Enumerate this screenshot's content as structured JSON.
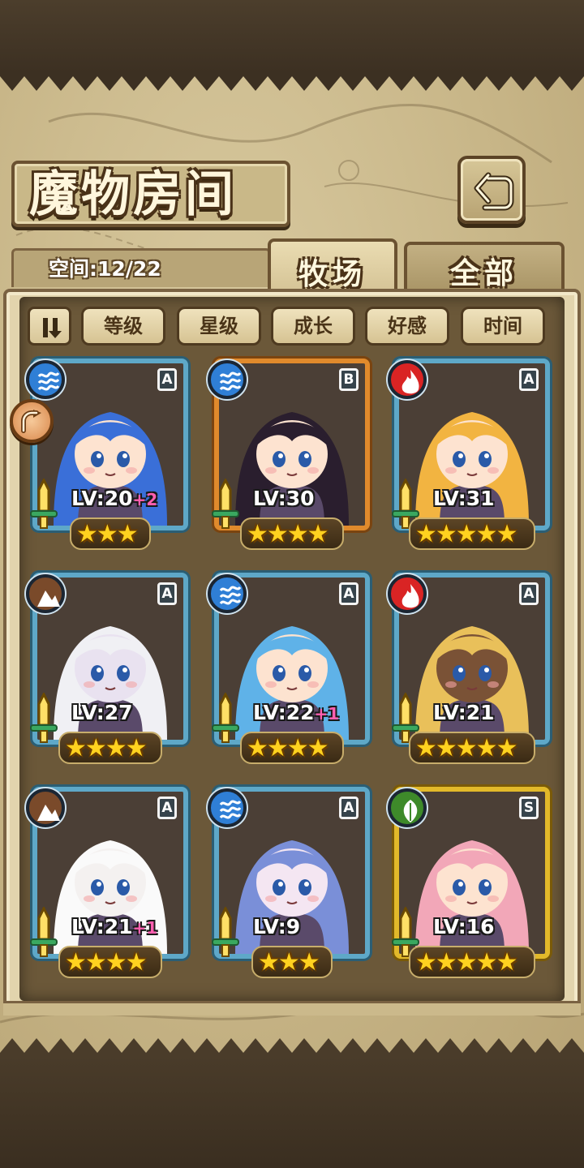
{
  "header": {
    "title": "魔物房间",
    "back_icon": "return-arrow-icon"
  },
  "tabs": {
    "capacity_text": "空间:12/22",
    "ranch_label": "牧场",
    "all_label": "全部",
    "active": "牧场"
  },
  "sort": {
    "toggle_icon": "sort-order-icon",
    "buttons": [
      "等级",
      "星级",
      "成长",
      "好感",
      "时间"
    ]
  },
  "colors": {
    "water": "#2f7fd6",
    "fire": "#d92424",
    "earth": "#7a4a2a",
    "nature": "#3e8a2a",
    "star": "#ffd21f",
    "bonus": "#ff5fb0"
  },
  "monsters": [
    {
      "element": "water",
      "rank": "A",
      "level": "LV:20",
      "bonus": "+2",
      "stars": "★★★",
      "star_count": 3,
      "hair": "#3a6fd8",
      "skin": "#fde3d0"
    },
    {
      "element": "water",
      "rank": "B",
      "level": "LV:30",
      "bonus": "",
      "stars": "★★★★",
      "star_count": 4,
      "hair": "#2a1e2e",
      "skin": "#fde3d0"
    },
    {
      "element": "fire",
      "rank": "A",
      "level": "LV:31",
      "bonus": "",
      "stars": "★★★★★",
      "star_count": 5,
      "hair": "#f2b441",
      "skin": "#fde3d0"
    },
    {
      "element": "earth",
      "rank": "A",
      "level": "LV:27",
      "bonus": "",
      "stars": "★★★★",
      "star_count": 4,
      "hair": "#f0f0f4",
      "skin": "#e9e2f0"
    },
    {
      "element": "water",
      "rank": "A",
      "level": "LV:22",
      "bonus": "+1",
      "stars": "★★★★",
      "star_count": 4,
      "hair": "#5fb2e8",
      "skin": "#fde3d0"
    },
    {
      "element": "fire",
      "rank": "A",
      "level": "LV:21",
      "bonus": "",
      "stars": "★★★★★",
      "star_count": 5,
      "hair": "#e9c05a",
      "skin": "#7a5236"
    },
    {
      "element": "earth",
      "rank": "A",
      "level": "LV:21",
      "bonus": "+1",
      "stars": "★★★★",
      "star_count": 4,
      "hair": "#fafafa",
      "skin": "#f4f1f0"
    },
    {
      "element": "water",
      "rank": "A",
      "level": "LV:9",
      "bonus": "",
      "stars": "★★★",
      "star_count": 3,
      "hair": "#7a8fd8",
      "skin": "#f4e6f2"
    },
    {
      "element": "nature",
      "rank": "S",
      "level": "LV:16",
      "bonus": "",
      "stars": "★★★★★",
      "star_count": 5,
      "hair": "#f2a7b8",
      "skin": "#fde3d0"
    }
  ]
}
